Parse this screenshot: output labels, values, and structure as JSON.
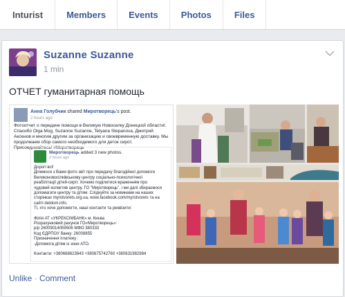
{
  "tabs": [
    "Inturist",
    "Members",
    "Events",
    "Photos",
    "Files"
  ],
  "post": {
    "author": "Suzanne Suzanne",
    "time": "1 min",
    "text": "ОТЧЕТ гуманитарная помощь"
  },
  "shared": {
    "author": "Анна Голубчик",
    "action": "shared",
    "target": "Миротворець",
    "suffix": "'s post.",
    "time": "2 hours ago",
    "text": "Фотоотчет о передаче помощи в Великую Новоселку Донецкой области!. Спасибо Olga Mog, Suzanne Suzanne, Tetyana Stepanova, Дмитрий Аксенов и многим другим за организацию и своевременную доставку. Мы продолжаем сбор самого необходимого для деток сирот. Присоединяйтесь! #Миротворець",
    "inner_author": "Миротворець",
    "inner_action": "added 3 new photos.",
    "inner_time": "2 hours ago",
    "inner_lines": [
      "Дорогі всі!",
      "Ділимося з Вами фото звіт про передачу благодійної допомоги",
      "Великоновосілківському центру соціально-психологічної",
      "реабілітації дітей-сиріт. Хочемо поділитися враженням про",
      "чудовий колектив центру. ГО \"Миротворець\", і ми далі збираємося",
      "допомагати центру та дітям. Слідкуйте за новинами на наших",
      "сторінках myrotvorets.org.ua, www.facebook.com/myrotvorets та на",
      "сайті detdom.info.",
      "Ті, хто хоче допомогти, наші контакти та реквізити:",
      "",
      "Філія АТ «УКРЕКСІМБАНК» м. Києва",
      "Розрахунковий рахунок ГО«Миротворець»:",
      "р/р 26009014059506 МФО 380333",
      "Код ЄДРПОУ банку: 26008855",
      "Призначення платежу :",
      "-Допомога дітям із зони АТО.",
      "",
      "Контакти: +380668623643 +380675742760 +380631982984"
    ]
  },
  "actions": {
    "unlike": "Unlike",
    "sep": " · ",
    "comment": "Comment"
  },
  "colors": {
    "link": "#3b5998",
    "meta": "#8d949e",
    "border": "#d3d6db"
  }
}
